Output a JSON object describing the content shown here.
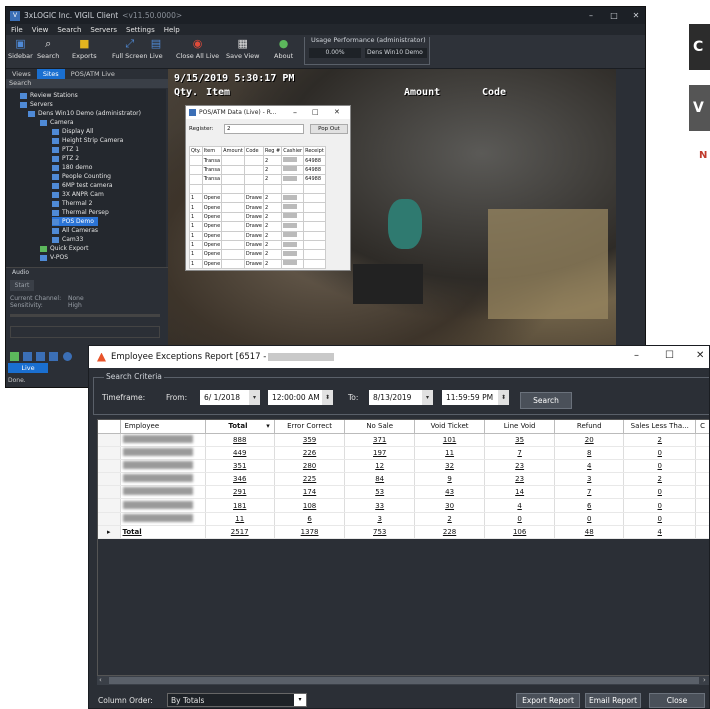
{
  "vigil": {
    "title": "3xLOGIC Inc. VIGIL Client",
    "version": "<v11.50.0000>",
    "menu": [
      "File",
      "View",
      "Search",
      "Servers",
      "Settings",
      "Help"
    ],
    "toolbar": [
      "Sidebar",
      "Search",
      "Exports",
      "Full Screen",
      "Live",
      "Close All Live",
      "Save View",
      "About"
    ],
    "usage_label": "Usage Performance (administrator)",
    "usage_pct": "0.00%",
    "usage_server": "Dens Win10 Demo",
    "tabs": [
      "Views",
      "Sites",
      "POS/ATM Live"
    ],
    "search_label": "Search",
    "tree": [
      "Review Stations",
      "Servers",
      "Dens Win10 Demo (administrator)",
      "Camera",
      "Display All",
      "Height Strip Camera",
      "PTZ 1",
      "PTZ 2",
      "180 demo",
      "People Counting",
      "6MP test camera",
      "3X ANPR Cam",
      "Thermal 2",
      "Thermal Persep",
      "POS Demo",
      "All Cameras",
      "Cam33",
      "Quick Export",
      "V-POS"
    ],
    "audio_label": "Audio",
    "audio_start": "Start",
    "audio_channel": "Current Channel:",
    "audio_channel_val": "None",
    "audio_sensitivity": "Sensitivity:",
    "audio_sensitivity_val": "High",
    "live_label": "Live",
    "status": "Done.",
    "video_timestamp": "9/15/2019 5:30:17 PM",
    "video_cols": [
      "Qty.",
      "Item",
      "Amount",
      "Code"
    ]
  },
  "pos_popup": {
    "title": "POS/ATM Data (Live) - R...",
    "register_label": "Register:",
    "register_value": "2",
    "popout": "Pop Out",
    "headers": [
      "Qty.",
      "Item",
      "Amount",
      "Code",
      "Reg #",
      "Cashier",
      "Receipt"
    ],
    "rows": [
      [
        "",
        "Transa",
        "",
        "",
        "2",
        "",
        "64988"
      ],
      [
        "",
        "Transa",
        "",
        "",
        "2",
        "",
        "64988"
      ],
      [
        "",
        "Transa",
        "",
        "",
        "2",
        "",
        "64988"
      ],
      [
        "",
        "",
        "",
        "",
        "",
        "",
        ""
      ],
      [
        "1",
        "Opene",
        "",
        "Drawe",
        "2",
        "",
        ""
      ],
      [
        "1",
        "Opene",
        "",
        "Drawe",
        "2",
        "",
        ""
      ],
      [
        "1",
        "Opene",
        "",
        "Drawe",
        "2",
        "",
        ""
      ],
      [
        "1",
        "Opene",
        "",
        "Drawe",
        "2",
        "",
        ""
      ],
      [
        "1",
        "Opene",
        "",
        "Drawe",
        "2",
        "",
        ""
      ],
      [
        "1",
        "Opene",
        "",
        "Drawe",
        "2",
        "",
        ""
      ],
      [
        "1",
        "Opene",
        "",
        "Drawe",
        "2",
        "",
        ""
      ],
      [
        "1",
        "Opene",
        "",
        "Drawe",
        "2",
        "",
        ""
      ]
    ]
  },
  "right_bg": {
    "letter1": "C",
    "letter2": "V",
    "letter3": "N"
  },
  "report": {
    "title": "Employee Exceptions Report [6517 -",
    "criteria_label": "Search Criteria",
    "timeframe_label": "Timeframe:",
    "from_label": "From:",
    "from_date": "6/ 1/2018",
    "from_time": "12:00:00 AM",
    "to_label": "To:",
    "to_date": "8/13/2019",
    "to_time": "11:59:59 PM",
    "search_button": "Search",
    "columns": [
      "Employee",
      "Total",
      "Error Correct",
      "No Sale",
      "Void Ticket",
      "Line Void",
      "Refund",
      "Sales Less Tha...",
      "C"
    ],
    "rows": [
      [
        "",
        "888",
        "359",
        "371",
        "101",
        "35",
        "20",
        "2"
      ],
      [
        "",
        "449",
        "226",
        "197",
        "11",
        "7",
        "8",
        "0"
      ],
      [
        "",
        "351",
        "280",
        "12",
        "32",
        "23",
        "4",
        "0"
      ],
      [
        "",
        "346",
        "225",
        "84",
        "9",
        "23",
        "3",
        "2"
      ],
      [
        "",
        "291",
        "174",
        "53",
        "43",
        "14",
        "7",
        "0"
      ],
      [
        "",
        "181",
        "108",
        "33",
        "30",
        "4",
        "6",
        "0"
      ],
      [
        "",
        "11",
        "6",
        "3",
        "2",
        "0",
        "0",
        "0"
      ],
      [
        "Total",
        "2517",
        "1378",
        "753",
        "228",
        "106",
        "48",
        "4"
      ]
    ],
    "column_order_label": "Column Order:",
    "column_order_value": "By Totals",
    "export_button": "Export Report",
    "email_button": "Email Report",
    "close_button": "Close"
  }
}
